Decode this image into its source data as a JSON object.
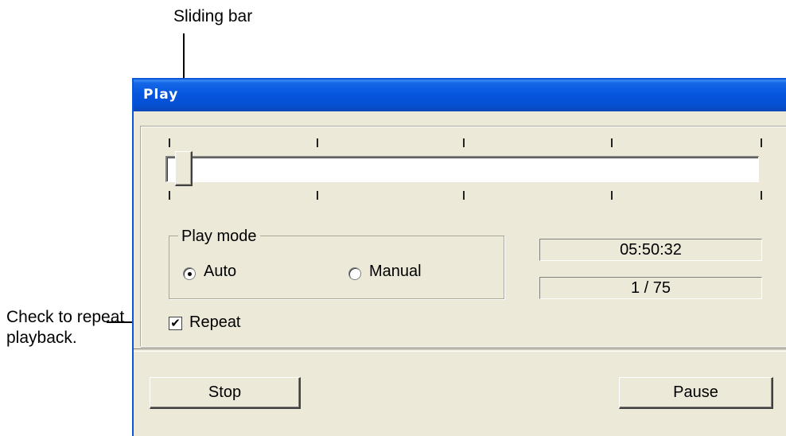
{
  "annotations": {
    "sliding_bar": "Sliding bar",
    "repeat_note": "Check to repeat playback."
  },
  "window": {
    "title": "Play"
  },
  "slider": {
    "position_fraction": 0.0,
    "tick_count": 5
  },
  "play_mode": {
    "legend": "Play mode",
    "options": [
      {
        "label": "Auto",
        "selected": true
      },
      {
        "label": "Manual",
        "selected": false
      }
    ]
  },
  "status": {
    "time": "05:50:32",
    "frame": "1 / 75"
  },
  "repeat": {
    "label": "Repeat",
    "checked": true,
    "check_glyph": "✔"
  },
  "buttons": {
    "stop": "Stop",
    "pause": "Pause"
  },
  "colors": {
    "titlebar": "#0656de",
    "window_bg": "#ece9d8"
  }
}
